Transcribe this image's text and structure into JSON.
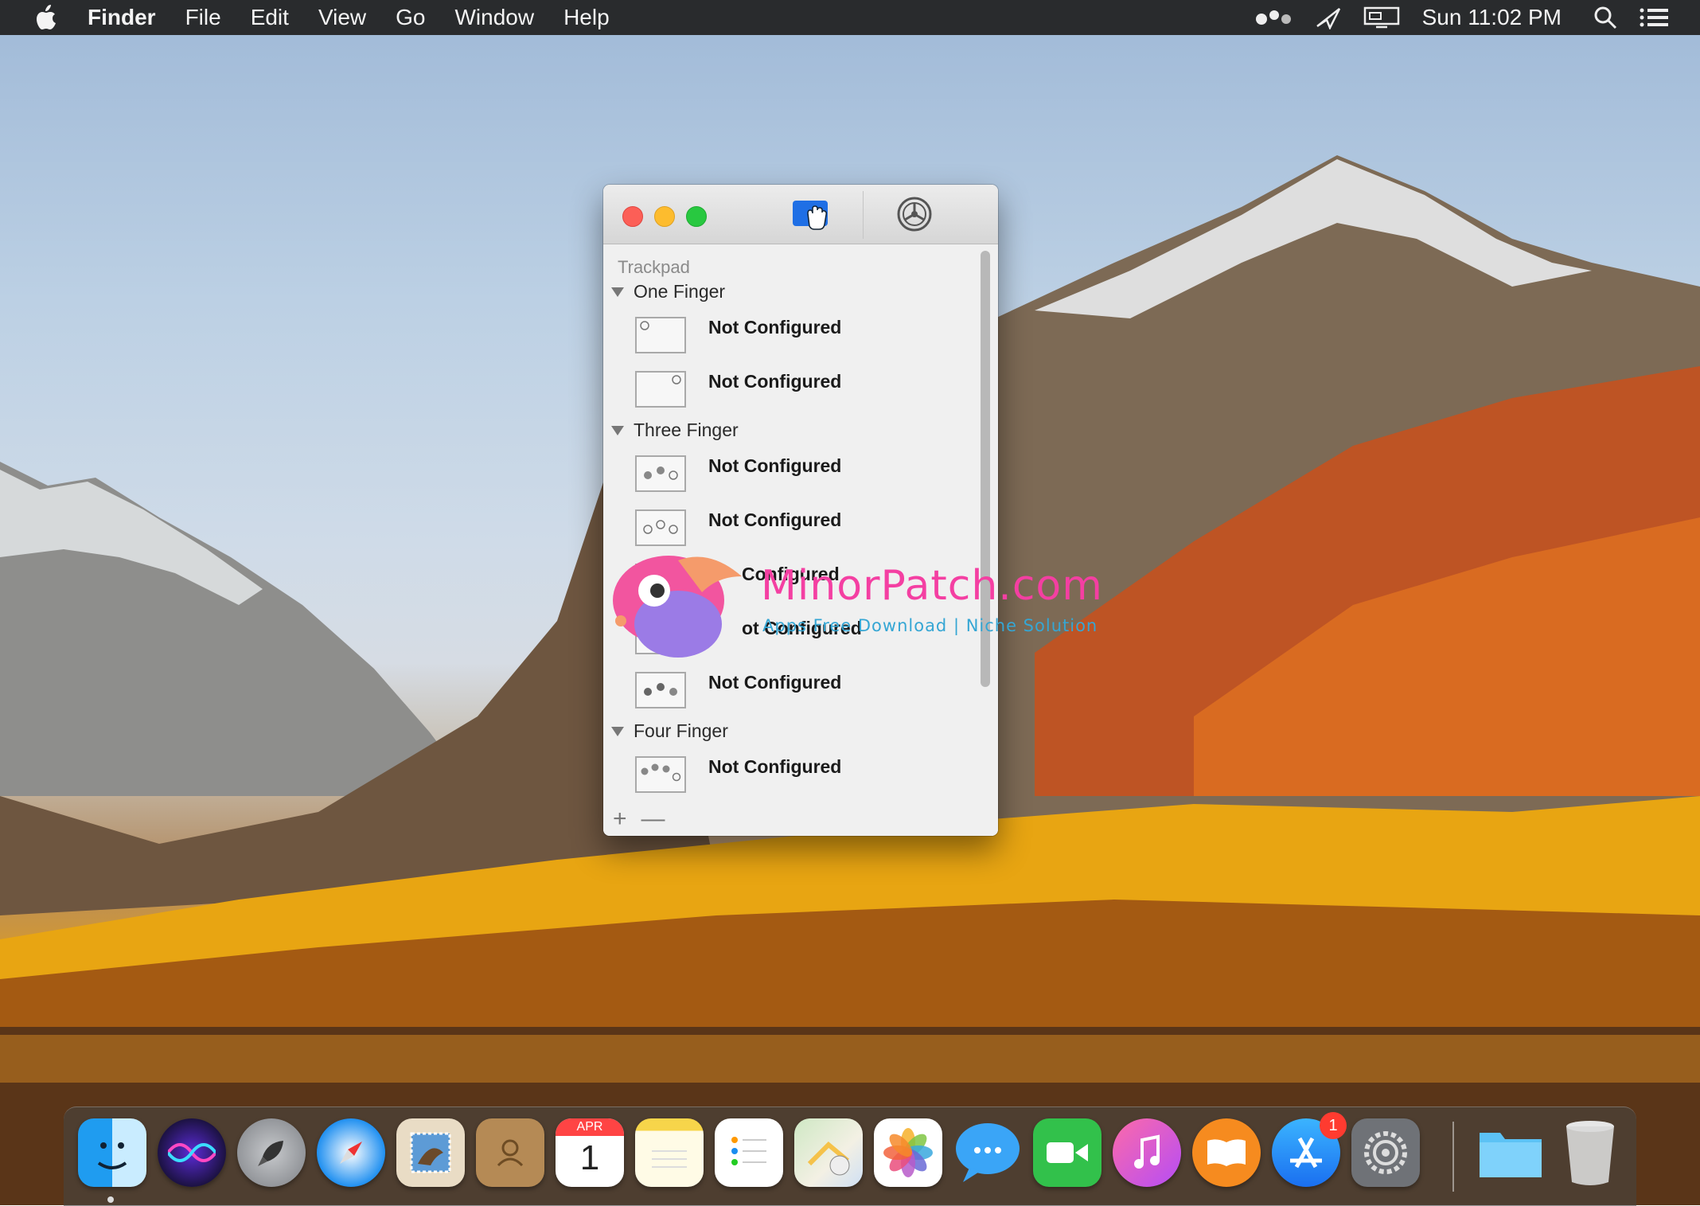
{
  "menubar": {
    "app_name": "Finder",
    "menus": [
      "File",
      "Edit",
      "View",
      "Go",
      "Window",
      "Help"
    ],
    "clock": "Sun 11:02 PM",
    "status_icons": [
      "dots-icon",
      "airplay-icon",
      "display-icon",
      "search-icon",
      "list-icon"
    ]
  },
  "window": {
    "toolbar": [
      "gestures-icon",
      "settings-gear-icon"
    ],
    "section_title": "Trackpad",
    "groups": [
      {
        "title": "One Finger",
        "items": [
          "Not Configured",
          "Not Configured"
        ]
      },
      {
        "title": "Three Finger",
        "items": [
          "Not Configured",
          "Not Configured",
          "Configured",
          "ot Configured",
          "Not Configured"
        ]
      },
      {
        "title": "Four Finger",
        "items": [
          "Not Configured"
        ]
      }
    ],
    "add_label": "+",
    "remove_label": "—"
  },
  "watermark": {
    "title": "MinorPatch.com",
    "subtitle": "Apps Free Download | Niche Solution"
  },
  "dock": {
    "apps": [
      "finder",
      "siri",
      "launchpad",
      "safari",
      "mail",
      "contacts",
      "calendar",
      "notes",
      "reminders",
      "maps",
      "photos",
      "messages",
      "facetime",
      "itunes",
      "ibooks",
      "app-store",
      "system-preferences",
      "downloads-folder",
      "trash"
    ],
    "calendar_month": "APR",
    "calendar_day": "1",
    "app_store_badge": "1"
  },
  "colors": {
    "menubar": "#1e1e1e",
    "window_bg": "#efefef",
    "accent_blue": "#1f6fe5",
    "watermark_pink": "#f43fa2",
    "watermark_blue": "#35a6d4"
  }
}
